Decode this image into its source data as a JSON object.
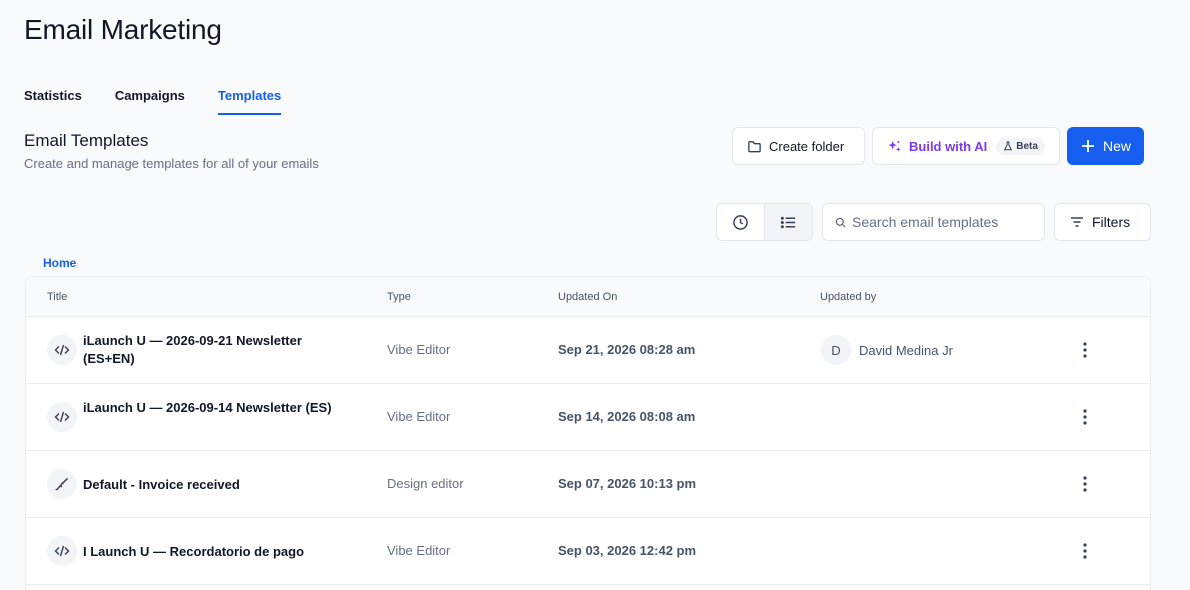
{
  "app": {
    "title": "Email Marketing"
  },
  "tabs": [
    {
      "label": "Statistics",
      "active": false
    },
    {
      "label": "Campaigns",
      "active": false
    },
    {
      "label": "Templates",
      "active": true
    }
  ],
  "section": {
    "title": "Email Templates",
    "subtitle": "Create and manage templates for all of your emails"
  },
  "actions": {
    "create_folder": "Create folder",
    "build_ai": "Build with AI",
    "beta": "Beta",
    "new": "New"
  },
  "search": {
    "placeholder": "Search email templates",
    "value": ""
  },
  "filters_label": "Filters",
  "breadcrumb": "Home",
  "table": {
    "headers": {
      "title": "Title",
      "type": "Type",
      "updated_on": "Updated On",
      "updated_by": "Updated by"
    },
    "rows": [
      {
        "icon": "code-icon",
        "title": "iLaunch U — 2026-09-21 Newsletter (ES+EN)",
        "type": "Vibe Editor",
        "updated_on": "Sep 21, 2026 08:28 am",
        "avatar": "D",
        "updated_by": "David Medina Jr"
      },
      {
        "icon": "code-icon",
        "title": "iLaunch U — 2026-09-14 Newsletter (ES)",
        "type": "Vibe Editor",
        "updated_on": "Sep 14, 2026 08:08 am",
        "avatar": "",
        "updated_by": ""
      },
      {
        "icon": "brush-icon",
        "title": "Default - Invoice received",
        "type": "Design editor",
        "updated_on": "Sep 07, 2026 10:13 pm",
        "avatar": "",
        "updated_by": ""
      },
      {
        "icon": "code-icon",
        "title": "I Launch U — Recordatorio de pago",
        "type": "Vibe Editor",
        "updated_on": "Sep 03, 2026 12:42 pm",
        "avatar": "",
        "updated_by": ""
      }
    ]
  },
  "colors": {
    "accent": "#155eef",
    "ai": "#7c3aed"
  }
}
